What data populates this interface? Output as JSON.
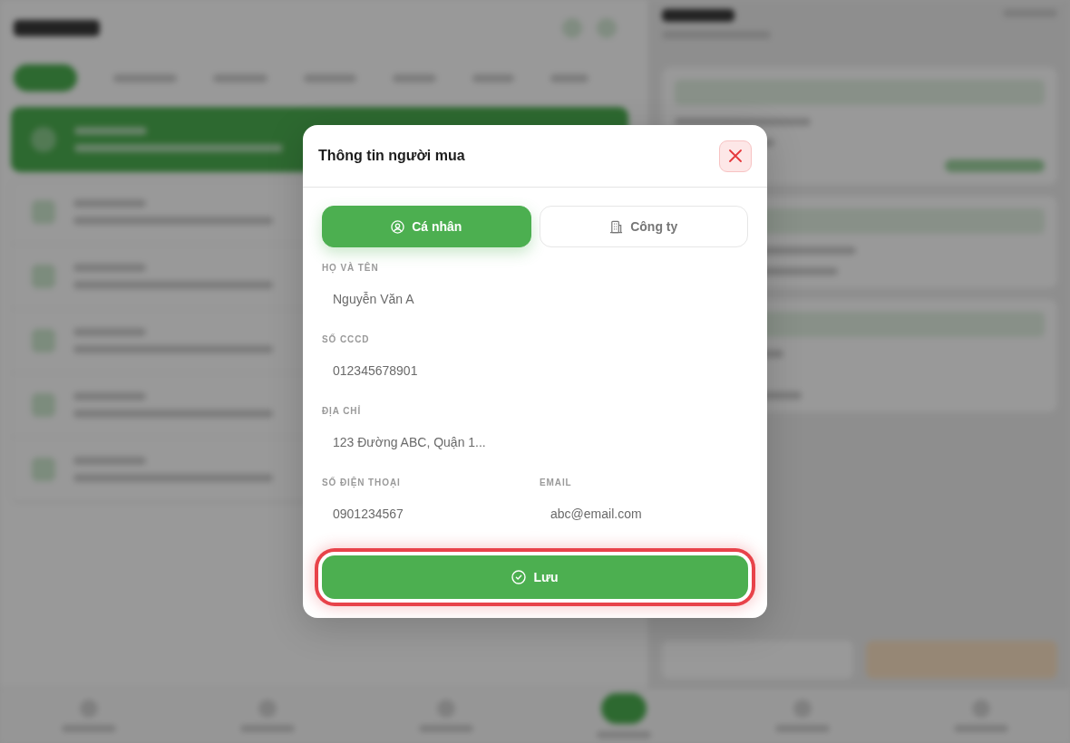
{
  "dialog": {
    "title": "Thông tin người mua"
  },
  "tabs": [
    {
      "label": "Cá nhân",
      "kind": "person",
      "selected": true
    },
    {
      "label": "Công ty",
      "kind": "company",
      "selected": false
    }
  ],
  "fields": [
    {
      "label": "HỌ VÀ TÊN",
      "value": "Nguyễn Văn A"
    },
    {
      "label": "SỐ CCCD",
      "value": "012345678901"
    },
    {
      "label": "ĐỊA CHỈ",
      "value": "123 Đường ABC, Quận 1..."
    }
  ],
  "contact_fields": [
    {
      "label": "SỐ ĐIỆN THOẠI",
      "value": "0901234567"
    },
    {
      "label": "EMAIL",
      "value": "abc@email.com"
    }
  ],
  "save_button": {
    "label": "Lưu",
    "focused": true
  }
}
